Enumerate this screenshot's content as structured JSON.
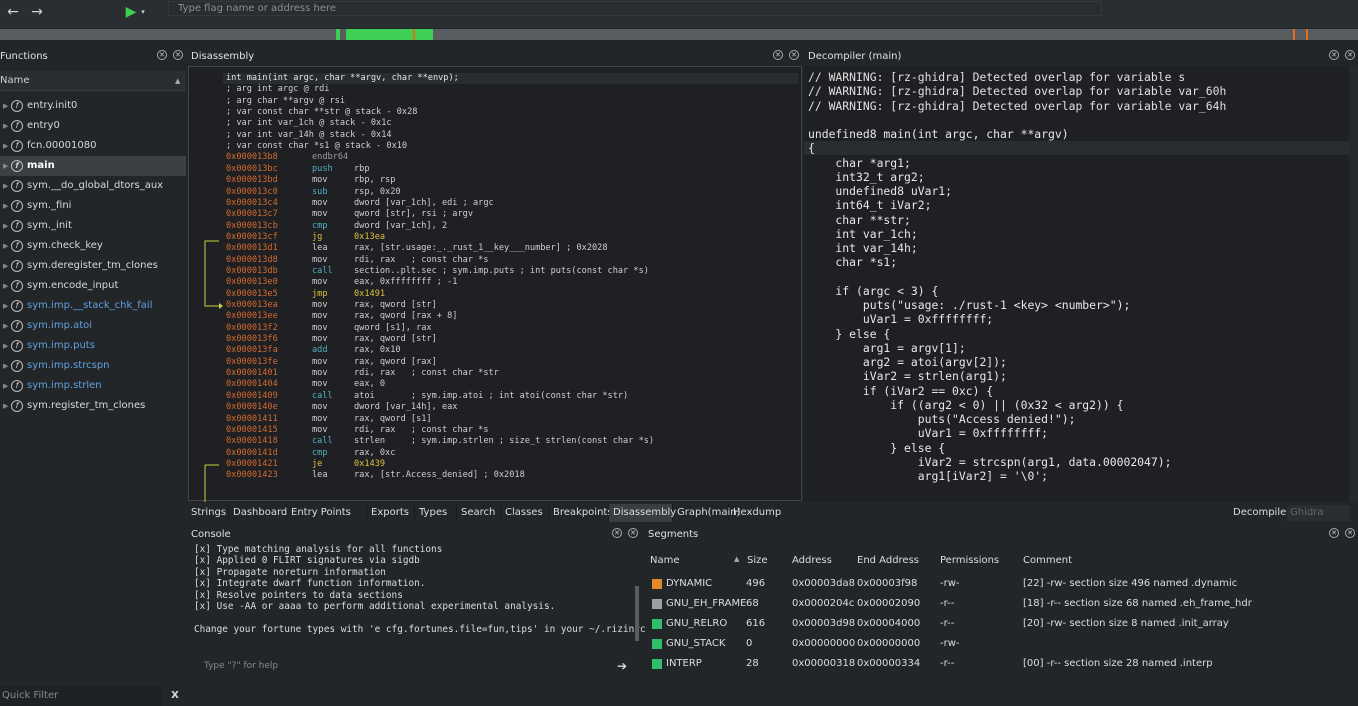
{
  "toolbar": {
    "back_icon": "arrow-left-icon",
    "forward_icon": "arrow-right-icon",
    "run_icon": "play-icon",
    "address_placeholder": "Type flag name or address here"
  },
  "functions_panel": {
    "title": "Functions",
    "column_header": "Name",
    "items": [
      {
        "label": "entry.init0",
        "kind": "normal"
      },
      {
        "label": "entry0",
        "kind": "normal"
      },
      {
        "label": "fcn.00001080",
        "kind": "normal"
      },
      {
        "label": "main",
        "kind": "selected"
      },
      {
        "label": "sym.__do_global_dtors_aux",
        "kind": "normal"
      },
      {
        "label": "sym._fini",
        "kind": "normal"
      },
      {
        "label": "sym._init",
        "kind": "normal"
      },
      {
        "label": "sym.check_key",
        "kind": "normal"
      },
      {
        "label": "sym.deregister_tm_clones",
        "kind": "normal"
      },
      {
        "label": "sym.encode_input",
        "kind": "normal"
      },
      {
        "label": "sym.imp.__stack_chk_fail",
        "kind": "import"
      },
      {
        "label": "sym.imp.atoi",
        "kind": "import"
      },
      {
        "label": "sym.imp.puts",
        "kind": "import"
      },
      {
        "label": "sym.imp.strcspn",
        "kind": "import"
      },
      {
        "label": "sym.imp.strlen",
        "kind": "import"
      },
      {
        "label": "sym.register_tm_clones",
        "kind": "normal"
      }
    ],
    "quick_filter_placeholder": "Quick Filter",
    "clear_filter_label": "X"
  },
  "disassembly": {
    "title": "Disassembly",
    "header_lines": [
      "int main(int argc, char **argv, char **envp);",
      "; arg int argc @ rdi",
      "; arg char **argv @ rsi",
      "; var const char **str @ stack - 0x28",
      "; var int var_1ch @ stack - 0x1c",
      "; var int var_14h @ stack - 0x14",
      "; var const char *s1 @ stack - 0x10"
    ],
    "lines": [
      {
        "addr": "0x000013b8",
        "mn": "endbr64",
        "ops": "",
        "cls": "gr"
      },
      {
        "addr": "0x000013bc",
        "mn": "push",
        "ops": "rbp",
        "cls": "jmp"
      },
      {
        "addr": "0x000013bd",
        "mn": "mov",
        "ops": "rbp, rsp",
        "cls": ""
      },
      {
        "addr": "0x000013c0",
        "mn": "sub",
        "ops": "rsp, 0x20",
        "cls": "jmp"
      },
      {
        "addr": "0x000013c4",
        "mn": "mov",
        "ops": "dword [var_1ch], edi ; argc",
        "cls": ""
      },
      {
        "addr": "0x000013c7",
        "mn": "mov",
        "ops": "qword [str], rsi ; argv",
        "cls": ""
      },
      {
        "addr": "0x000013cb",
        "mn": "cmp",
        "ops": "dword [var_1ch], 2",
        "cls": "jmp"
      },
      {
        "addr": "0x000013cf",
        "mn": "jg",
        "ops": "0x13ea",
        "cls": "y"
      },
      {
        "addr": "0x000013d1",
        "mn": "lea",
        "ops": "rax, [str.usage:_._rust_1__key___number] ; 0x2028",
        "cls": ""
      },
      {
        "addr": "0x000013d8",
        "mn": "mov",
        "ops": "rdi, rax   ; const char *s",
        "cls": ""
      },
      {
        "addr": "0x000013db",
        "mn": "call",
        "ops": "section..plt.sec ; sym.imp.puts ; int puts(const char *s)",
        "cls": "jmp"
      },
      {
        "addr": "0x000013e0",
        "mn": "mov",
        "ops": "eax, 0xffffffff ; -1",
        "cls": ""
      },
      {
        "addr": "0x000013e5",
        "mn": "jmp",
        "ops": "0x1491",
        "cls": "y"
      },
      {
        "addr": "0x000013ea",
        "mn": "mov",
        "ops": "rax, qword [str]",
        "cls": ""
      },
      {
        "addr": "0x000013ee",
        "mn": "mov",
        "ops": "rax, qword [rax + 8]",
        "cls": ""
      },
      {
        "addr": "0x000013f2",
        "mn": "mov",
        "ops": "qword [s1], rax",
        "cls": ""
      },
      {
        "addr": "0x000013f6",
        "mn": "mov",
        "ops": "rax, qword [str]",
        "cls": ""
      },
      {
        "addr": "0x000013fa",
        "mn": "add",
        "ops": "rax, 0x10",
        "cls": "jmp"
      },
      {
        "addr": "0x000013fe",
        "mn": "mov",
        "ops": "rax, qword [rax]",
        "cls": ""
      },
      {
        "addr": "0x00001401",
        "mn": "mov",
        "ops": "rdi, rax   ; const char *str",
        "cls": ""
      },
      {
        "addr": "0x00001404",
        "mn": "mov",
        "ops": "eax, 0",
        "cls": ""
      },
      {
        "addr": "0x00001409",
        "mn": "call",
        "ops": "atoi       ; sym.imp.atoi ; int atoi(const char *str)",
        "cls": "jmp"
      },
      {
        "addr": "0x0000140e",
        "mn": "mov",
        "ops": "dword [var_14h], eax",
        "cls": ""
      },
      {
        "addr": "0x00001411",
        "mn": "mov",
        "ops": "rax, qword [s1]",
        "cls": ""
      },
      {
        "addr": "0x00001415",
        "mn": "mov",
        "ops": "rdi, rax   ; const char *s",
        "cls": ""
      },
      {
        "addr": "0x00001418",
        "mn": "call",
        "ops": "strlen     ; sym.imp.strlen ; size_t strlen(const char *s)",
        "cls": "jmp"
      },
      {
        "addr": "0x0000141d",
        "mn": "cmp",
        "ops": "rax, 0xc",
        "cls": "jmp"
      },
      {
        "addr": "0x00001421",
        "mn": "je",
        "ops": "0x1439",
        "cls": "y"
      },
      {
        "addr": "0x00001423",
        "mn": "lea",
        "ops": "rax, [str.Access_denied] ; 0x2018",
        "cls": ""
      }
    ]
  },
  "decompiler": {
    "title": "Decompiler (main)",
    "lines": [
      "// WARNING: [rz-ghidra] Detected overlap for variable s",
      "// WARNING: [rz-ghidra] Detected overlap for variable var_60h",
      "// WARNING: [rz-ghidra] Detected overlap for variable var_64h",
      "",
      "undefined8 main(int argc, char **argv)",
      "{",
      "    char *arg1;",
      "    int32_t arg2;",
      "    undefined8 uVar1;",
      "    int64_t iVar2;",
      "    char **str;",
      "    int var_1ch;",
      "    int var_14h;",
      "    char *s1;",
      "",
      "    if (argc < 3) {",
      "        puts(\"usage: ./rust-1 <key> <number>\");",
      "        uVar1 = 0xffffffff;",
      "    } else {",
      "        arg1 = argv[1];",
      "        arg2 = atoi(argv[2]);",
      "        iVar2 = strlen(arg1);",
      "        if (iVar2 == 0xc) {",
      "            if ((arg2 < 0) || (0x32 < arg2)) {",
      "                puts(\"Access denied!\");",
      "                uVar1 = 0xffffffff;",
      "            } else {",
      "                iVar2 = strcspn(arg1, data.00002047);",
      "                arg1[iVar2] = '\\0';"
    ],
    "label": "Decompiler:",
    "engine_value": "Ghidra"
  },
  "tabs": [
    "Strings",
    "Dashboard",
    "Entry Points",
    "Exports",
    "Types",
    "Search",
    "Classes",
    "Breakpoints",
    "Disassembly",
    "Graph(main)",
    "Hexdump"
  ],
  "active_tab": "Disassembly",
  "console": {
    "title": "Console",
    "lines": [
      "[x] Type matching analysis for all functions",
      "[x] Applied 0 FLIRT signatures via sigdb",
      "[x] Propagate noreturn information",
      "[x] Integrate dwarf function information.",
      "[x] Resolve pointers to data sections",
      "[x] Use -AA or aaaa to perform additional experimental analysis.",
      "",
      "Change your fortune types with 'e cfg.fortunes.file=fun,tips' in your ~/.rizinrc"
    ],
    "input_placeholder": "Type \"?\" for help"
  },
  "segments": {
    "title": "Segments",
    "headers": [
      "Name",
      "Size",
      "Address",
      "End Address",
      "Permissions",
      "Comment"
    ],
    "rows": [
      {
        "color": "#e08a2a",
        "name": "DYNAMIC",
        "size": "496",
        "address": "0x00003da8",
        "end": "0x00003f98",
        "perm": "-rw-",
        "comment": "[22] -rw- section size 496 named .dynamic"
      },
      {
        "color": "#9aa0a6",
        "name": "GNU_EH_FRAME",
        "size": "68",
        "address": "0x0000204c",
        "end": "0x00002090",
        "perm": "-r--",
        "comment": "[18] -r-- section size 68 named .eh_frame_hdr"
      },
      {
        "color": "#2fbf6a",
        "name": "GNU_RELRO",
        "size": "616",
        "address": "0x00003d98",
        "end": "0x00004000",
        "perm": "-r--",
        "comment": "[20] -rw- section size 8 named .init_array"
      },
      {
        "color": "#2fbf6a",
        "name": "GNU_STACK",
        "size": "0",
        "address": "0x00000000",
        "end": "0x00000000",
        "perm": "-rw-",
        "comment": ""
      },
      {
        "color": "#2fbf6a",
        "name": "INTERP",
        "size": "28",
        "address": "0x00000318",
        "end": "0x00000334",
        "perm": "-r--",
        "comment": "[00] -r-- section size 28 named .interp"
      }
    ]
  }
}
